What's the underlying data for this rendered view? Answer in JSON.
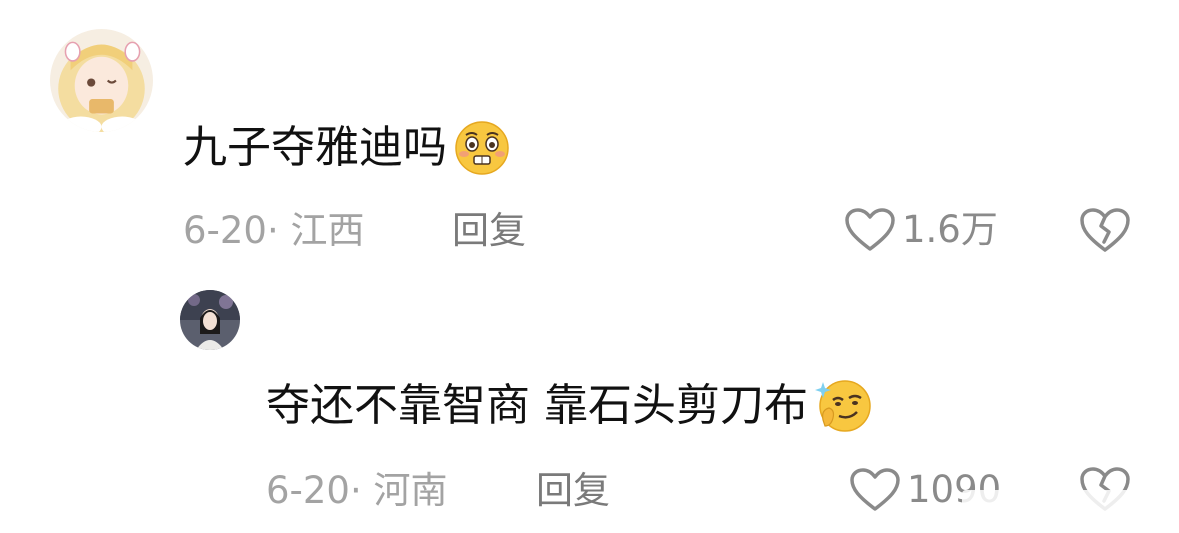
{
  "comments": [
    {
      "text": "九子夺雅迪吗",
      "emoji": "pleading-face-emoji",
      "date_location": "6-20· 江西",
      "reply_label": "回复",
      "like_count": "1.6万"
    },
    {
      "text": "夺还不靠智商 靠石头剪刀布",
      "emoji": "smirk-thinking-emoji",
      "date_location": "6-20· 河南",
      "reply_label": "回复",
      "like_count": "1090"
    }
  ],
  "colors": {
    "text": "#111111",
    "meta": "#a3a3a3",
    "reply": "#7a7a7a",
    "icon": "#8a8a8a"
  }
}
